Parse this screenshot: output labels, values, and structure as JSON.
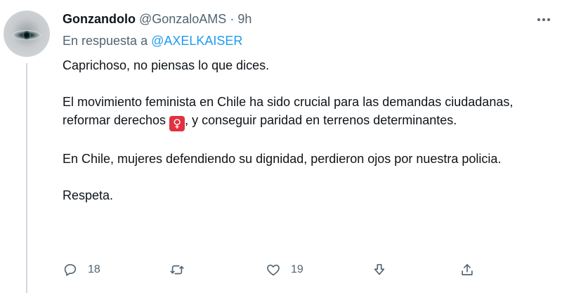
{
  "tweet": {
    "display_name": "Gonzandolo",
    "handle": "@GonzaloAMS",
    "separator": "·",
    "time": "9h",
    "reply_prefix": "En respuesta a",
    "reply_to": "@AXELKAISER",
    "body": {
      "p1": "Caprichoso, no piensas lo que dices.",
      "p2_before_emoji": "El movimiento feminista en Chile ha sido crucial para las demandas ciudadanas, reformar derechos ",
      "emoji": "♀",
      "p2_after_emoji": ", y conseguir paridad en terrenos determinantes.",
      "p3": "En Chile, mujeres defendiendo su dignidad, perdieron ojos por nuestra policia.",
      "p4": "Respeta."
    },
    "actions": {
      "replies": "18",
      "retweets": "",
      "likes": "19"
    }
  },
  "icons": {
    "more": "more-horizontal-icon",
    "reply": "comment-icon",
    "retweet": "retweet-icon",
    "like": "heart-icon",
    "download": "download-icon",
    "share": "share-icon"
  },
  "colors": {
    "text": "#0f1419",
    "secondary": "#536471",
    "link": "#1d9bf0",
    "thread_line": "#cfd9de",
    "emoji_bg": "#e2313f"
  }
}
